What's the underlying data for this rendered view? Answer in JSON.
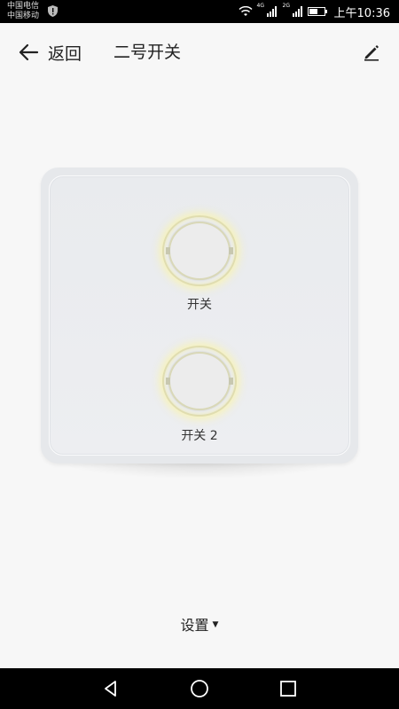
{
  "status_bar": {
    "carrier_1": "中国电信",
    "carrier_2": "中国移动",
    "net_1": "4G",
    "net_2": "2G",
    "time": "上午10:36"
  },
  "header": {
    "back_label": "返回",
    "title": "二号开关"
  },
  "panel": {
    "switches": [
      {
        "label": "开关"
      },
      {
        "label": "开关 2"
      }
    ]
  },
  "settings": {
    "label": "设置"
  },
  "icons": {
    "back": "arrow-left-icon",
    "edit": "pencil-icon",
    "nav_back": "triangle-back-icon",
    "nav_home": "circle-home-icon",
    "nav_recent": "square-recent-icon"
  },
  "colors": {
    "glow": "#f5f0a8",
    "panel": "#e8eaed",
    "background": "#f7f7f7"
  }
}
